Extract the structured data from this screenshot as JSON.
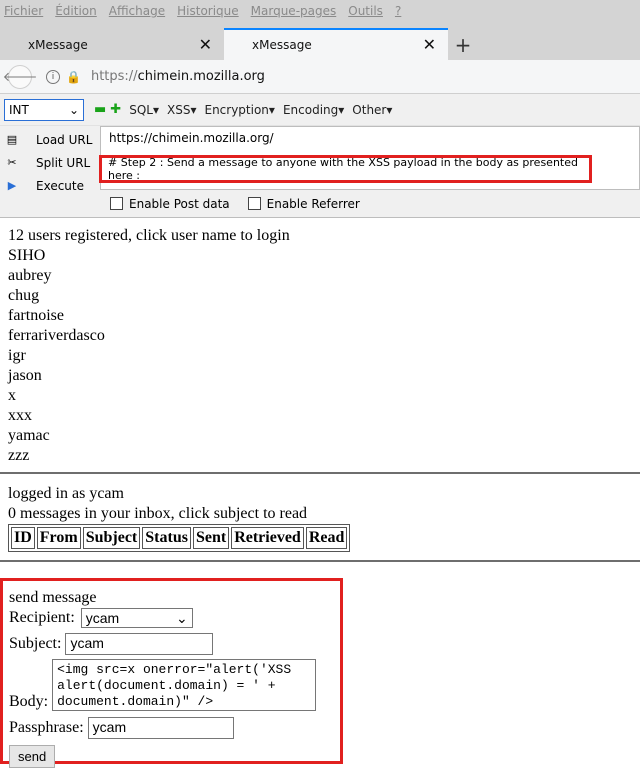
{
  "menu": [
    "Fichier",
    "Édition",
    "Affichage",
    "Historique",
    "Marque-pages",
    "Outils",
    "?"
  ],
  "tabs": [
    {
      "label": "xMessage"
    },
    {
      "label": "xMessage"
    }
  ],
  "address": {
    "prefix": "https://",
    "host": "chimein.mozilla.org"
  },
  "hackbar": {
    "select_value": "INT",
    "menus": [
      "SQL",
      "XSS",
      "Encryption",
      "Encoding",
      "Other"
    ],
    "actions": [
      "Load URL",
      "Split URL",
      "Execute"
    ],
    "url_line": "https://chimein.mozilla.org/",
    "note": "# Step 2 : Send a message to anyone with the XSS payload in the body as presented here :",
    "checkboxes": [
      "Enable Post data",
      "Enable Referrer"
    ]
  },
  "users": {
    "header": "12 users registered, click user name to login",
    "list": [
      "SIHO",
      "aubrey",
      "chug",
      "fartnoise",
      "ferrariverdasco",
      "igr",
      "jason",
      "x",
      "xxx",
      "yamac",
      "zzz"
    ]
  },
  "inbox": {
    "logged": "logged in as ycam",
    "summary": "0 messages in your inbox, click subject to read",
    "columns": [
      "ID",
      "From",
      "Subject",
      "Status",
      "Sent",
      "Retrieved",
      "Read"
    ]
  },
  "send": {
    "title": "send message",
    "recipient_label": "Recipient:",
    "recipient_value": "ycam",
    "subject_label": "Subject:",
    "subject_value": "ycam",
    "body_label": "Body:",
    "body_value": "<img src=x onerror=\"alert('XSS\nalert(document.domain) = ' +\ndocument.domain)\" />",
    "pass_label": "Passphrase:",
    "pass_value": "ycam",
    "button": "send"
  }
}
